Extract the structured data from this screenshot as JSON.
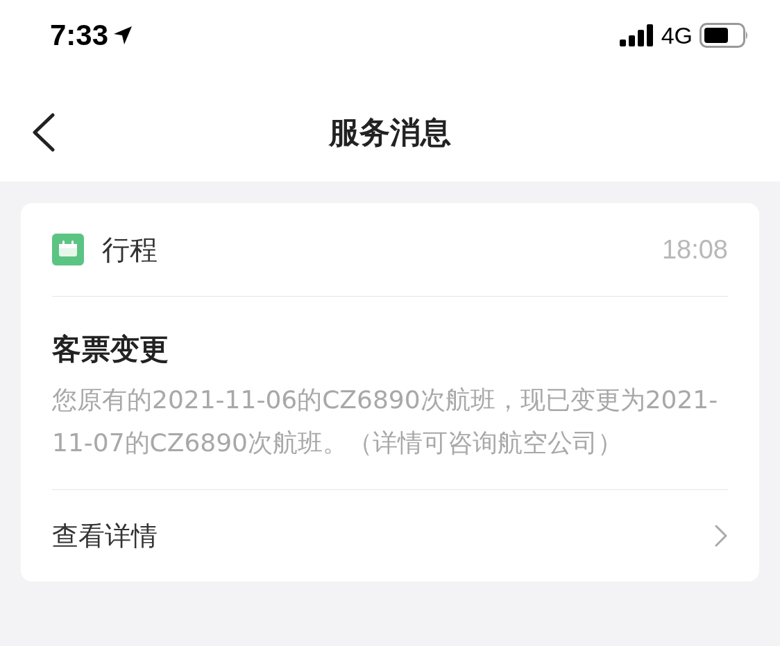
{
  "status_bar": {
    "time": "7:33",
    "network": "4G"
  },
  "nav": {
    "title": "服务消息"
  },
  "messages": [
    {
      "category": "行程",
      "time": "18:08",
      "title": "客票变更",
      "body": "您原有的2021-11-06的CZ6890次航班，现已变更为2021-11-07的CZ6890次航班。（详情可咨询航空公司）",
      "action": "查看详情"
    }
  ]
}
